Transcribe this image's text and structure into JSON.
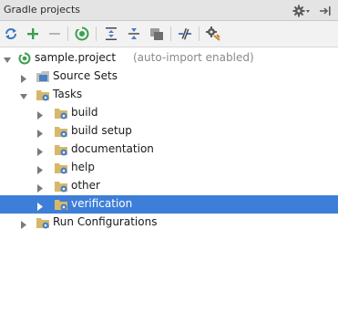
{
  "header": {
    "title": "Gradle projects"
  },
  "toolbar": {
    "buttons": [
      "refresh-icon",
      "add-icon",
      "remove-icon",
      "execute-task-icon",
      "expand-all-icon",
      "collapse-all-icon",
      "attach-icon",
      "toggle-offline-icon",
      "settings-icon"
    ]
  },
  "tree": {
    "project": {
      "name": "sample.project",
      "note": "(auto-import enabled)"
    },
    "source_sets": "Source Sets",
    "tasks": "Tasks",
    "task_groups": [
      "build",
      "build setup",
      "documentation",
      "help",
      "other",
      "verification"
    ],
    "selected": "verification",
    "run_configurations": "Run Configurations"
  },
  "colors": {
    "selection": "#3d7ed8",
    "accent_green": "#3aa14e",
    "folder": "#d7b86b",
    "gear": "#4a7fc1"
  }
}
